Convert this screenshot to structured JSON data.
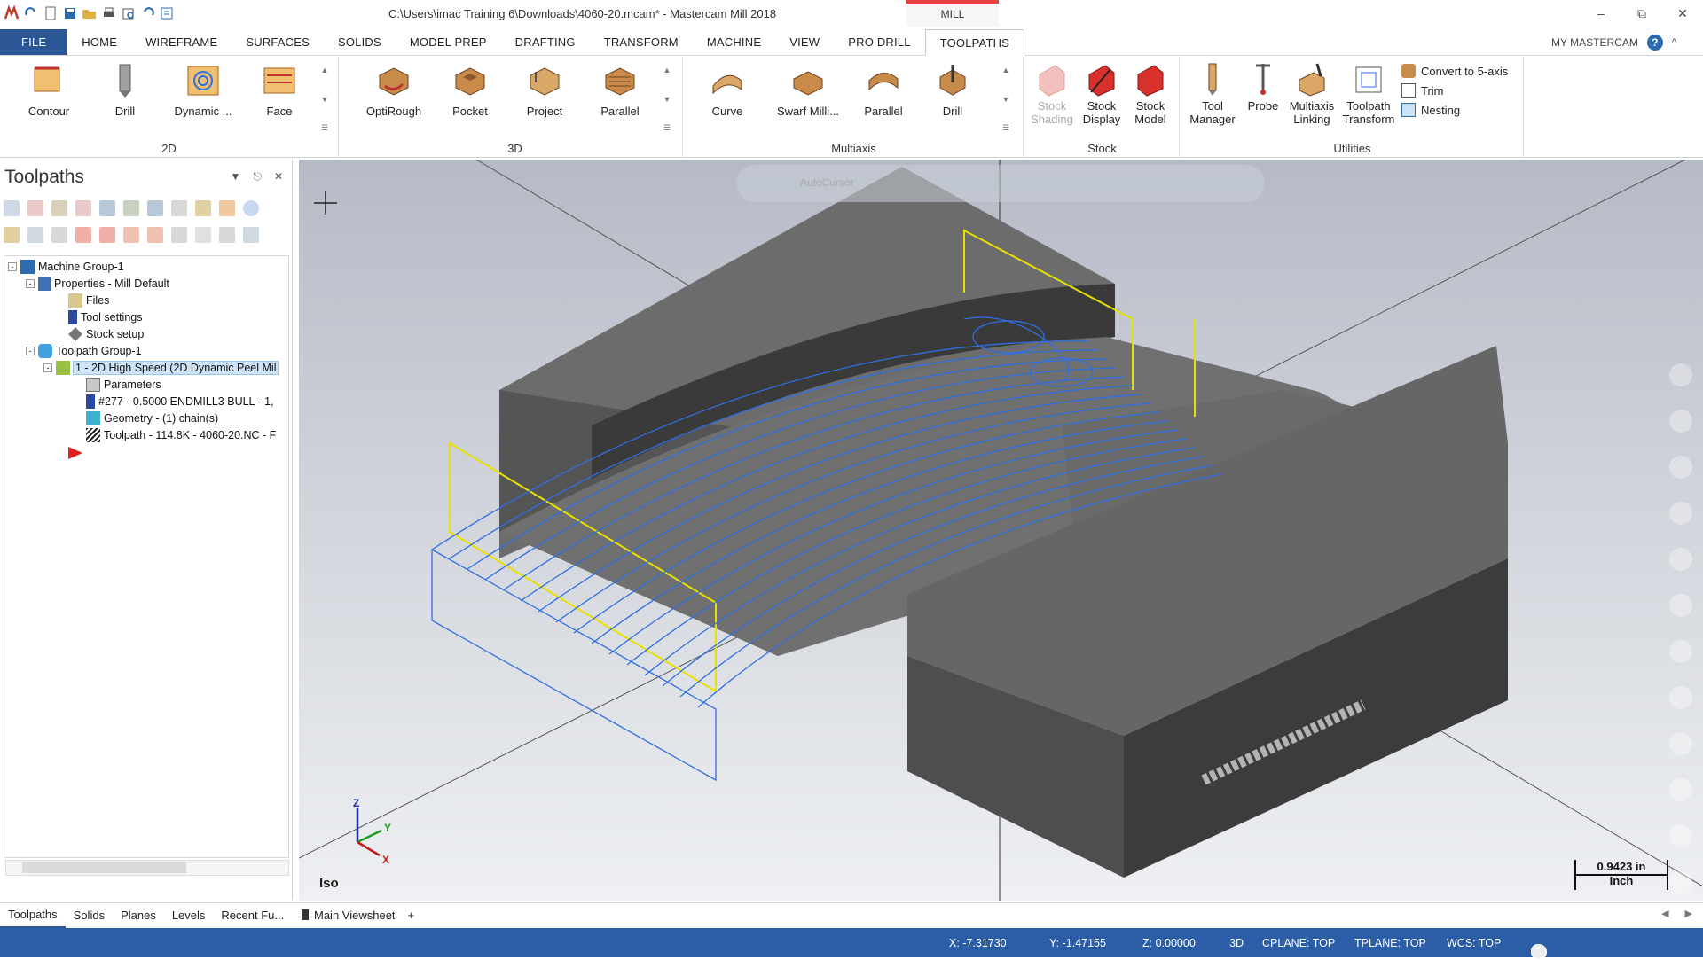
{
  "window": {
    "title": "C:\\Users\\imac Training 6\\Downloads\\4060-20.mcam* - Mastercam Mill 2018",
    "context_tab": "MILL"
  },
  "ribbon_tabs": [
    "FILE",
    "HOME",
    "WIREFRAME",
    "SURFACES",
    "SOLIDS",
    "MODEL PREP",
    "DRAFTING",
    "TRANSFORM",
    "MACHINE",
    "VIEW",
    "PRO DRILL",
    "TOOLPATHS"
  ],
  "active_tab": "TOOLPATHS",
  "my_mastercam": "MY MASTERCAM",
  "help_glyph": "?",
  "groups": {
    "g2d": {
      "label": "2D",
      "buttons": [
        "Contour",
        "Drill",
        "Dynamic ...",
        "Face"
      ]
    },
    "g3d": {
      "label": "3D",
      "buttons": [
        "OptiRough",
        "Pocket",
        "Project",
        "Parallel"
      ]
    },
    "multiaxis": {
      "label": "Multiaxis",
      "buttons": [
        "Curve",
        "Swarf Milli...",
        "Parallel",
        "Drill"
      ]
    },
    "stock": {
      "label": "Stock",
      "buttons": [
        "Stock Shading",
        "Stock Display",
        "Stock Model"
      ]
    },
    "utilities": {
      "label": "Utilities",
      "buttons": [
        "Tool Manager",
        "Probe",
        "Multiaxis Linking",
        "Toolpath Transform"
      ],
      "small": [
        "Convert to 5-axis",
        "Trim",
        "Nesting"
      ]
    }
  },
  "panel": {
    "title": "Toolpaths",
    "tree": [
      {
        "label": "Machine Group-1"
      },
      {
        "label": "Properties - Mill Default"
      },
      {
        "label": "Files"
      },
      {
        "label": "Tool settings"
      },
      {
        "label": "Stock setup"
      },
      {
        "label": "Toolpath Group-1"
      },
      {
        "label": "1 - 2D High Speed (2D Dynamic Peel Mil"
      },
      {
        "label": "Parameters"
      },
      {
        "label": "#277 - 0.5000 ENDMILL3 BULL -  1,"
      },
      {
        "label": "Geometry - (1) chain(s)"
      },
      {
        "label": "Toolpath - 114.8K - 4060-20.NC - F"
      }
    ]
  },
  "bottom_tabs": [
    "Toolpaths",
    "Solids",
    "Planes",
    "Levels",
    "Recent Fu..."
  ],
  "viewsheet": {
    "label": "Main Viewsheet",
    "add": "+"
  },
  "viewport": {
    "view_label": "Iso",
    "scale_value": "0.9423 in",
    "scale_unit": "Inch",
    "autocursor_label": "AutoCursor",
    "axis_x": "X",
    "axis_y": "Y",
    "axis_z": "Z"
  },
  "status": {
    "x": "X:   -7.31730",
    "y": "Y:   -1.47155",
    "z": "Z:   0.00000",
    "mode": "3D",
    "cplane": "CPLANE: TOP",
    "tplane": "TPLANE: TOP",
    "wcs": "WCS: TOP"
  },
  "colors": {
    "file_tab": "#2b5797",
    "status_bar": "#2c5ea8",
    "toolpath": "#2f6fe0",
    "context_accent": "#e8423f",
    "chain": "#e8e000"
  }
}
